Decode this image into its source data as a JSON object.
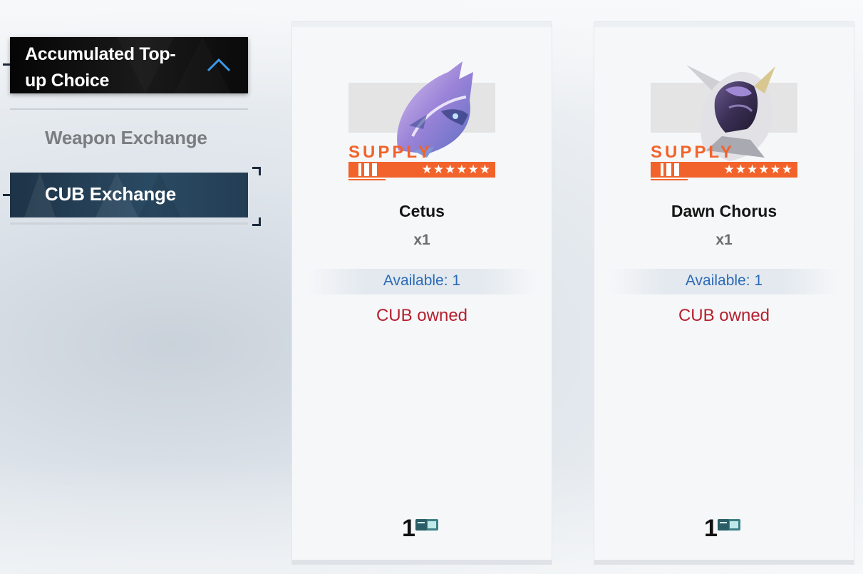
{
  "menu": {
    "parent_label": "Accumulated Top-up Choice",
    "items": [
      {
        "label": "Weapon Exchange",
        "selected": false
      },
      {
        "label": "CUB Exchange",
        "selected": true
      }
    ]
  },
  "cards": [
    {
      "badge_text": "SUPPLY",
      "stars": "★★★★★★",
      "name": "Cetus",
      "quantity": "x1",
      "available": "Available: 1",
      "status": "CUB owned",
      "price": "1",
      "currency_icon": "ticket-icon"
    },
    {
      "badge_text": "SUPPLY",
      "stars": "★★★★★★",
      "name": "Dawn Chorus",
      "quantity": "x1",
      "available": "Available: 1",
      "status": "CUB owned",
      "price": "1",
      "currency_icon": "ticket-icon"
    }
  ],
  "colors": {
    "accent_orange": "#f2632b",
    "available_blue": "#2c6ab6",
    "owned_red": "#b5202f",
    "chevron_blue": "#3b9ae6"
  }
}
